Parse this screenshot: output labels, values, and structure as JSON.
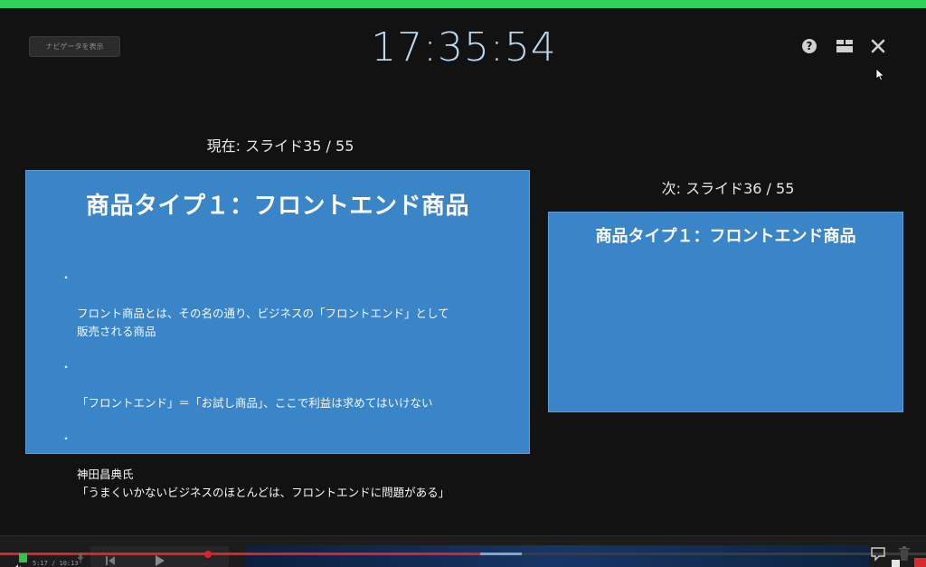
{
  "header": {
    "navigator_button_label": "ナビゲータを表示",
    "clock": "17:35:54"
  },
  "current_slide": {
    "label": "現在: スライド35 / 55",
    "title": "商品タイプ１：フロントエンド商品",
    "bullets": [
      "フロント商品とは、その名の通り、ビジネスの「フロントエンド」として\n販売される商品",
      "「フロントエンド」＝「お試し商品」、ここで利益は求めてはいけない",
      "神田昌典氏\n「うまくいかないビジネスのほとんどは、フロントエンドに問題がある」"
    ],
    "bullet_marker": "・"
  },
  "next_slide": {
    "label": "次: スライド36 / 55",
    "title": "商品タイプ１：フロントエンド商品"
  },
  "player": {
    "time": "5:17 / 10:13",
    "progress_fraction": 0.519,
    "buffered_fraction": 0.563
  },
  "colors": {
    "accent_green": "#2ed15a",
    "slide_blue": "#3a85c8",
    "clock_blue": "#b9d6ec",
    "progress_red": "#e0202a"
  },
  "icons": {
    "help": "help-icon",
    "layout": "layout-icon",
    "close": "close-icon",
    "cursor": "mouse-cursor-icon"
  }
}
